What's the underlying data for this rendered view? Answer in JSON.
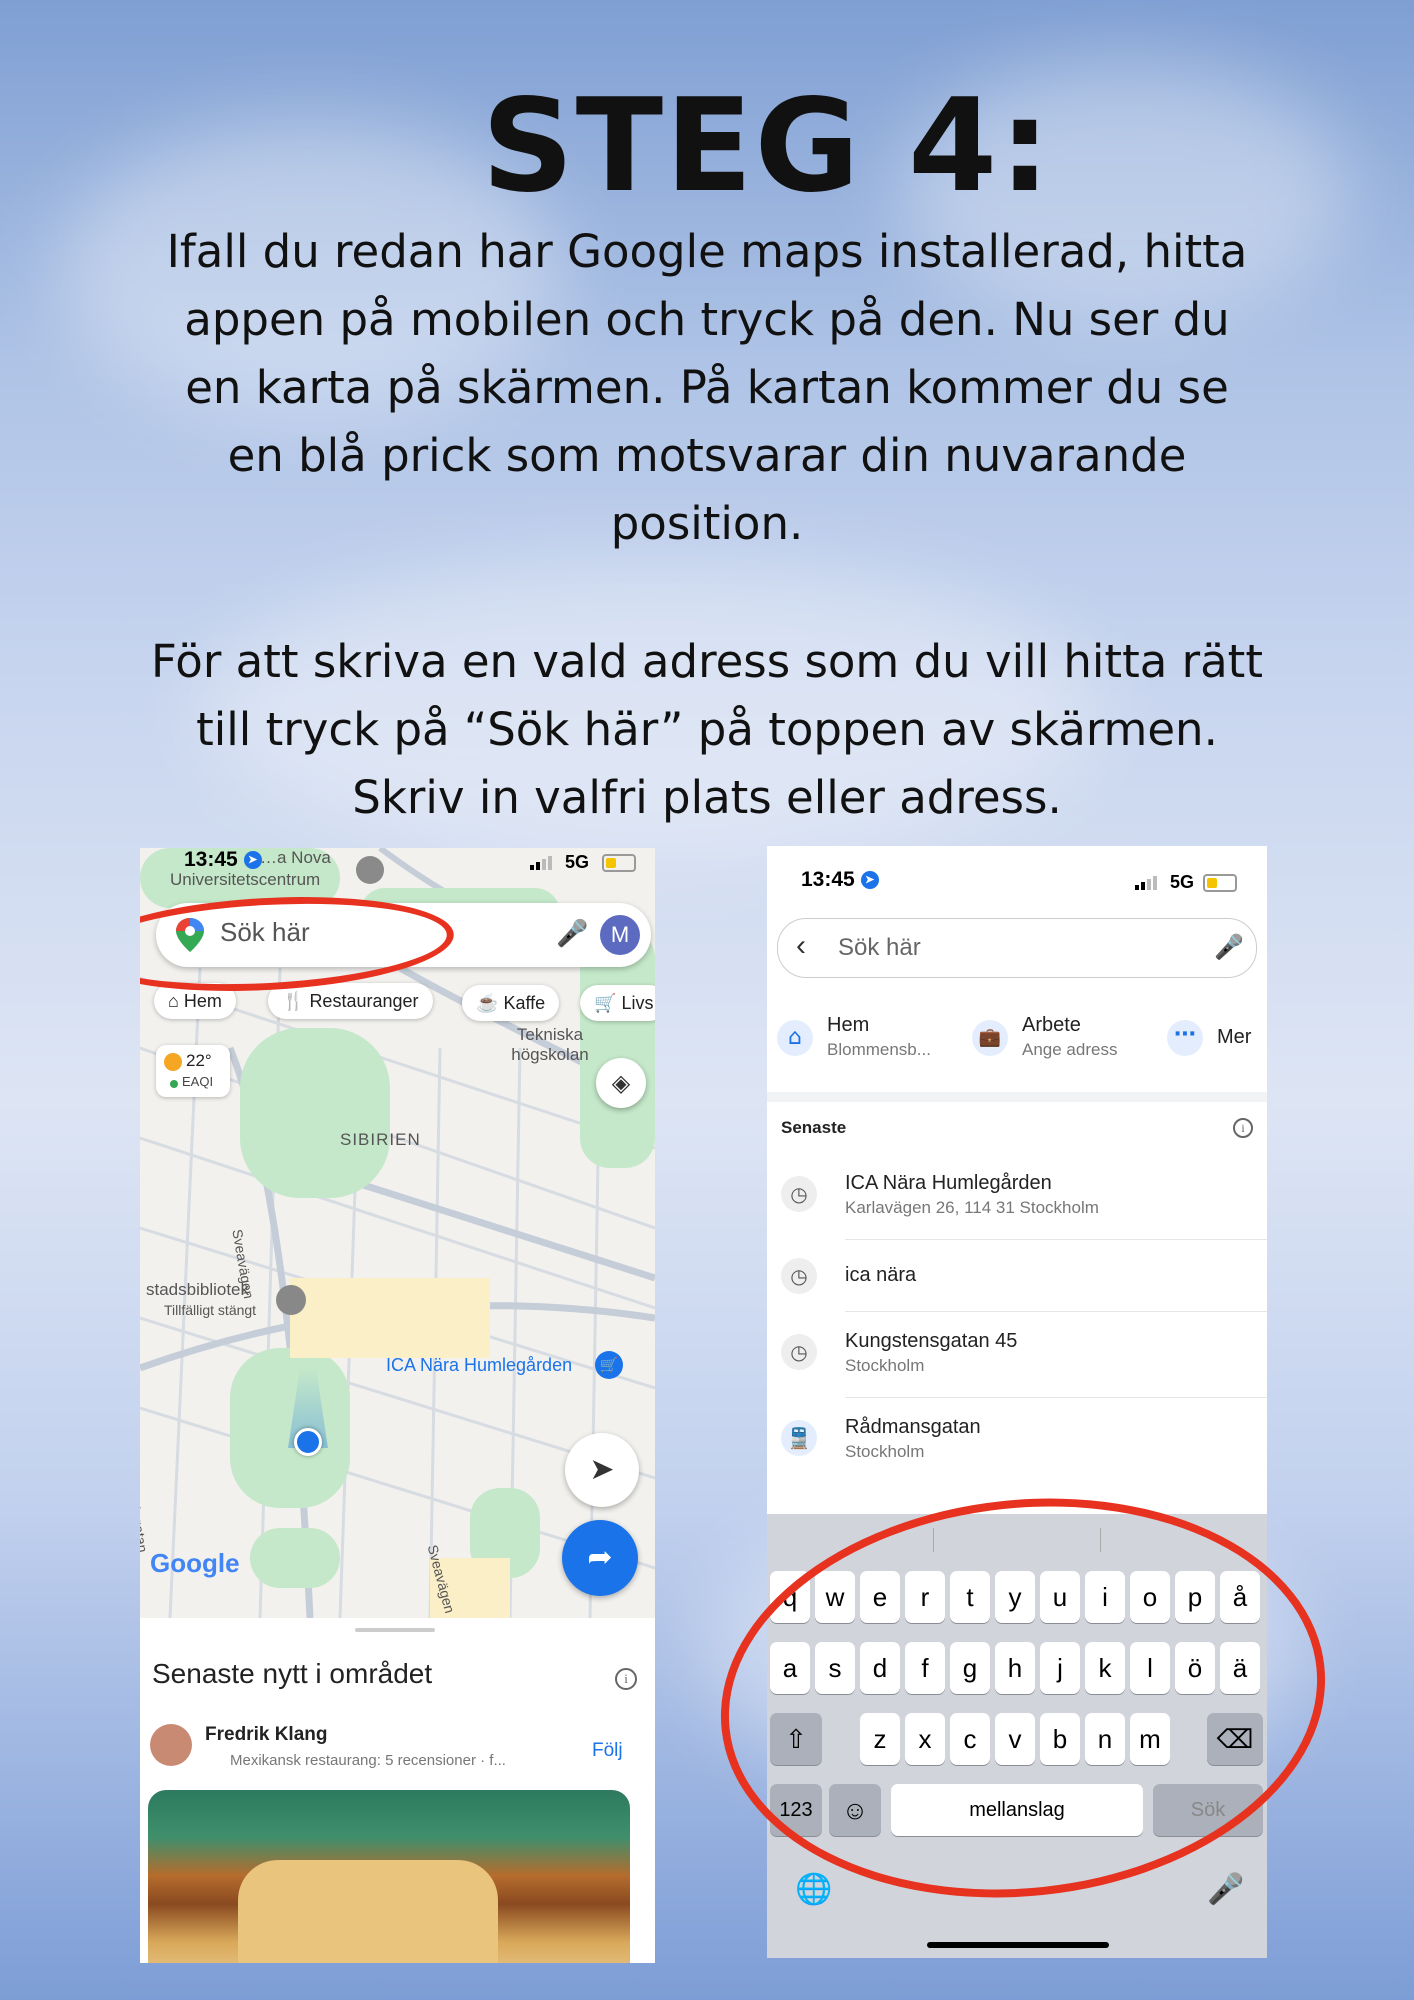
{
  "title": "STEG 4:",
  "paragraph1": "Ifall du redan har Google maps installerad, hitta appen på mobilen och tryck på den. Nu ser du en karta på skärmen. På kartan kommer du se en blå prick som motsvarar din nuvarande position.",
  "paragraph2": "För att  skriva en vald adress som du vill hitta rätt till tryck på “Sök här” på toppen av skärmen. Skriv in valfri plats eller adress.",
  "left_phone": {
    "time": "13:45",
    "network": "5G",
    "search_placeholder": "Sök här",
    "avatar_letter": "M",
    "chips": [
      "Hem",
      "Restauranger",
      "Kaffe",
      "Livs"
    ],
    "weather_temp": "22°",
    "weather_aqi": "EAQI",
    "map_labels": {
      "universitetscentrum": "Universitetscentrum",
      "stockholm_univ": "…a Nova",
      "tekniska": "Tekniska högskolan",
      "sibirien": "SIBIRIEN",
      "sveavagen1": "Sveavägen",
      "sveavagen2": "Sveavägen",
      "dalagatan": "Dalagatan",
      "stadsbibliotek": "stadsbibliotek",
      "tillfalligt": "Tillfälligt stängt",
      "ica": "ICA Nära Humlegården",
      "google": "Google"
    },
    "sheet_title": "Senaste nytt i området",
    "reviewer_name": "Fredrik Klang",
    "reviewer_meta": "Mexikansk restaurang: 5 recensioner · f...",
    "follow_label": "Följ"
  },
  "right_phone": {
    "time": "13:45",
    "network": "5G",
    "search_placeholder": "Sök här",
    "shortcuts": [
      {
        "title": "Hem",
        "sub": "Blommensb..."
      },
      {
        "title": "Arbete",
        "sub": "Ange adress"
      },
      {
        "title": "Mer",
        "sub": ""
      }
    ],
    "recent_header": "Senaste",
    "recents": [
      {
        "title": "ICA Nära Humlegården",
        "sub": "Karlavägen 26, 114 31 Stockholm",
        "icon": "clock-icon"
      },
      {
        "title": "ica nära",
        "sub": "",
        "icon": "clock-icon"
      },
      {
        "title": "Kungstensgatan 45",
        "sub": "Stockholm",
        "icon": "clock-icon"
      },
      {
        "title": "Rådmansgatan",
        "sub": "Stockholm",
        "icon": "train-icon"
      }
    ],
    "keyboard": {
      "row1": [
        "q",
        "w",
        "e",
        "r",
        "t",
        "y",
        "u",
        "i",
        "o",
        "p",
        "å"
      ],
      "row2": [
        "a",
        "s",
        "d",
        "f",
        "g",
        "h",
        "j",
        "k",
        "l",
        "ö",
        "ä"
      ],
      "row3": [
        "z",
        "x",
        "c",
        "v",
        "b",
        "n",
        "m"
      ],
      "numbers_key": "123",
      "space_label": "mellanslag",
      "search_key": "Sök"
    }
  },
  "colors": {
    "accent_blue": "#1a73e8",
    "annotation_red": "#e83220"
  }
}
